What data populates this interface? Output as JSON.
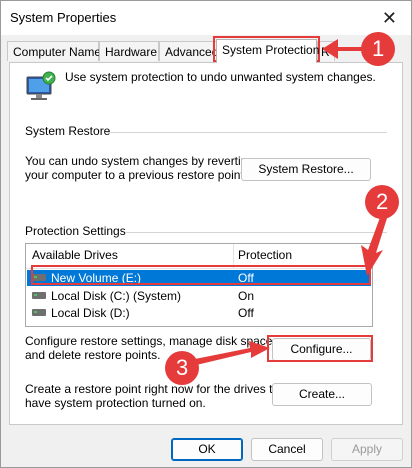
{
  "window": {
    "title": "System Properties",
    "close_icon": "close-icon"
  },
  "tabs": [
    {
      "label": "Computer Name"
    },
    {
      "label": "Hardware"
    },
    {
      "label": "Advanced"
    },
    {
      "label": "System Protection"
    },
    {
      "label": "R"
    }
  ],
  "intro": {
    "text": "Use system protection to undo unwanted system changes."
  },
  "system_restore": {
    "heading": "System Restore",
    "desc_line1": "You can undo system changes by reverting",
    "desc_line2": "your computer to a previous restore point.",
    "button": "System Restore..."
  },
  "protection": {
    "heading": "Protection Settings",
    "columns": [
      "Available Drives",
      "Protection"
    ],
    "rows": [
      {
        "drive": "New Volume (E:)",
        "status": "Off",
        "selected": true
      },
      {
        "drive": "Local Disk (C:) (System)",
        "status": "On",
        "selected": false
      },
      {
        "drive": "Local Disk (D:)",
        "status": "Off",
        "selected": false
      }
    ]
  },
  "configure": {
    "desc_line1": "Configure restore settings, manage disk space,",
    "desc_line2": "and delete restore points.",
    "button": "Configure..."
  },
  "create": {
    "desc_line1": "Create a restore point right now for the drives that",
    "desc_line2": "have system protection turned on.",
    "button": "Create..."
  },
  "footer": {
    "ok": "OK",
    "cancel": "Cancel",
    "apply": "Apply"
  },
  "annotations": {
    "step1": "1",
    "step2": "2",
    "step3": "3"
  },
  "colors": {
    "annotation_red": "#e53b3b",
    "selection_blue": "#0078d7",
    "accent_border": "#0067c0"
  }
}
